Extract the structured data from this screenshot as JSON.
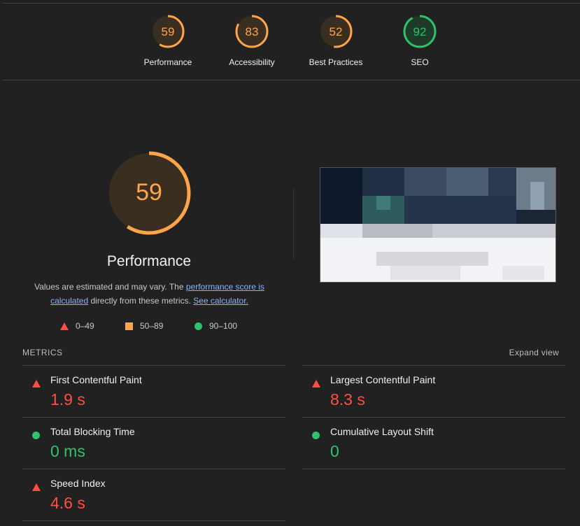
{
  "summary": {
    "gauges": [
      {
        "score": "59",
        "label": "Performance",
        "fraction": 0.59,
        "color": "#ffa44a"
      },
      {
        "score": "83",
        "label": "Accessibility",
        "fraction": 0.83,
        "color": "#ffa44a"
      },
      {
        "score": "52",
        "label": "Best Practices",
        "fraction": 0.52,
        "color": "#ffa44a"
      },
      {
        "score": "92",
        "label": "SEO",
        "fraction": 0.92,
        "color": "#2ec26a"
      }
    ]
  },
  "performance": {
    "score": "59",
    "fraction": 0.59,
    "title": "Performance",
    "desc_prefix": "Values are estimated and may vary. The ",
    "desc_link1": "performance score is calculated",
    "desc_middle": " directly from these metrics. ",
    "desc_link2": "See calculator."
  },
  "legend": {
    "fail": "0–49",
    "average": "50–89",
    "pass": "90–100"
  },
  "metrics": {
    "header": "METRICS",
    "expand_label": "Expand view",
    "items": [
      {
        "name": "First Contentful Paint",
        "value": "1.9 s",
        "status": "fail"
      },
      {
        "name": "Largest Contentful Paint",
        "value": "8.3 s",
        "status": "fail"
      },
      {
        "name": "Total Blocking Time",
        "value": "0 ms",
        "status": "pass"
      },
      {
        "name": "Cumulative Layout Shift",
        "value": "0",
        "status": "pass"
      },
      {
        "name": "Speed Index",
        "value": "4.6 s",
        "status": "fail"
      }
    ]
  },
  "colors": {
    "fail": "#ff4e42",
    "average": "#ffa44a",
    "pass": "#2ec26a"
  }
}
